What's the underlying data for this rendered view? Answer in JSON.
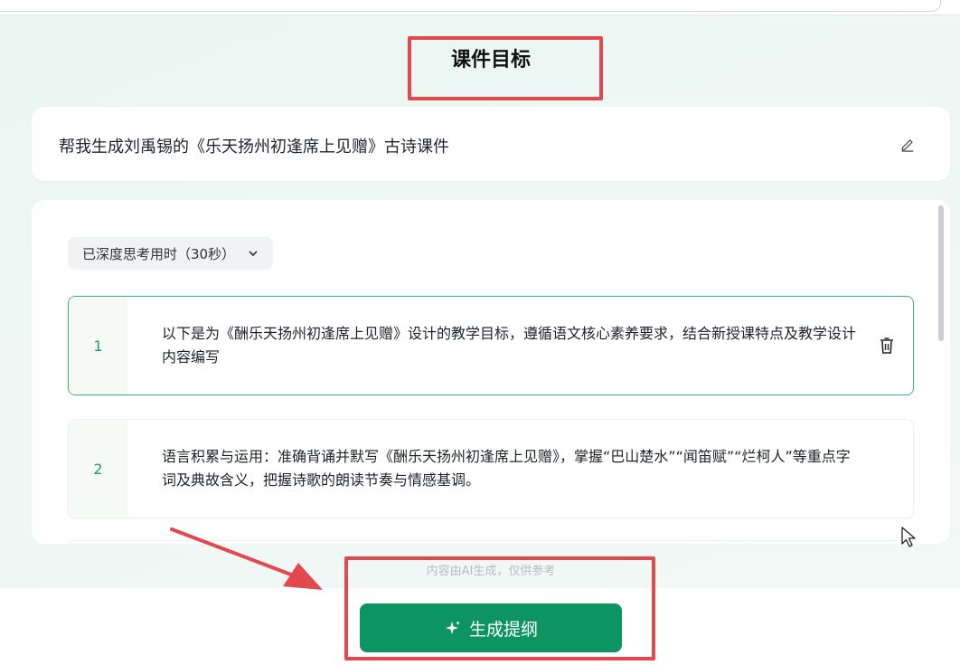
{
  "page": {
    "title": "课件目标"
  },
  "prompt": {
    "text": "帮我生成刘禹锡的《乐天扬州初逢席上见赠》古诗课件"
  },
  "thinking": {
    "label": "已深度思考用时（30秒）"
  },
  "objectives": [
    {
      "index": "1",
      "text": "以下是为《酬乐天扬州初逢席上见赠》设计的教学目标，遵循语文核心素养要求，结合新授课特点及教学设计内容编写"
    },
    {
      "index": "2",
      "text": "语言积累与运用：准确背诵并默写《酬乐天扬州初逢席上见赠》，掌握“巴山楚水”“闻笛赋”“烂柯人”等重点字词及典故含义，把握诗歌的朗读节奏与情感基调。"
    }
  ],
  "footer": {
    "disclaimer": "内容由AI生成，仅供参考",
    "generate_label": "生成提纲"
  },
  "colors": {
    "accent": "#0d9463",
    "highlight_border": "#3eb483",
    "annotation_red": "#e5474e"
  },
  "icons": [
    "edit-icon",
    "chevron-down-icon",
    "trash-icon",
    "sparkle-icon",
    "cursor-icon"
  ]
}
